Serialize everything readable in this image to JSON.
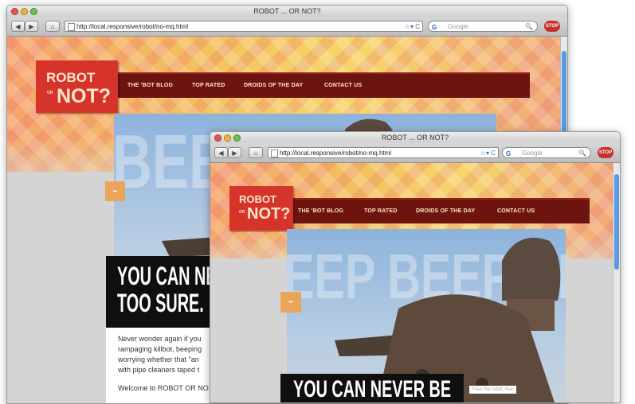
{
  "back_window": {
    "title": "ROBOT ... OR NOT?",
    "url": "http://local.responsive/robot/no-mq.html",
    "search_placeholder": "Google",
    "search_engine_icon": "G",
    "nav": [
      "THE 'BOT BLOG",
      "TOP RATED",
      "DROIDS OF THE DAY",
      "CONTACT US"
    ],
    "logo": {
      "line1": "ROBOT",
      "or": "OR",
      "line2": "NOT?"
    },
    "beep_text": "BEEP BEEP B",
    "tagline": [
      "YOU CAN NEVER BE",
      "TOO SURE."
    ],
    "body_lines": [
      "Never wonder again if you",
      "rampaging killbot, beeping",
      "worrying whether that \"an",
      "with pipe cleaners taped t",
      "Welcome to ROBOT OR NO"
    ],
    "square_glyph": "••"
  },
  "front_window": {
    "title": "ROBOT ... OR NOT?",
    "url": "http://local.responsive/robot/no-mq.html",
    "search_placeholder": "Google",
    "search_engine_icon": "G",
    "nav": [
      "THE 'BOT BLOG",
      "TOP RATED",
      "DROIDS OF THE DAY",
      "CONTACT US"
    ],
    "logo": {
      "line1": "ROBOT",
      "or": "OR",
      "line2": "NOT?"
    },
    "beep_text": "EEP BEEP BE",
    "tagline": [
      "YOU CAN NEVER BE"
    ],
    "fear_text": "Fear the robot, fear",
    "square_glyph": "••"
  },
  "toolbar": {
    "back": "◀",
    "forward": "▶",
    "home": "⌂",
    "reload": "C",
    "stop": "STOP",
    "star": "☆▾",
    "magnifier": "🔍"
  },
  "colors": {
    "nav_red": "#6e1410",
    "logo_red": "#d6332b",
    "accent_orange": "#e9a659",
    "scroll_blue": "#5a9ae0"
  }
}
